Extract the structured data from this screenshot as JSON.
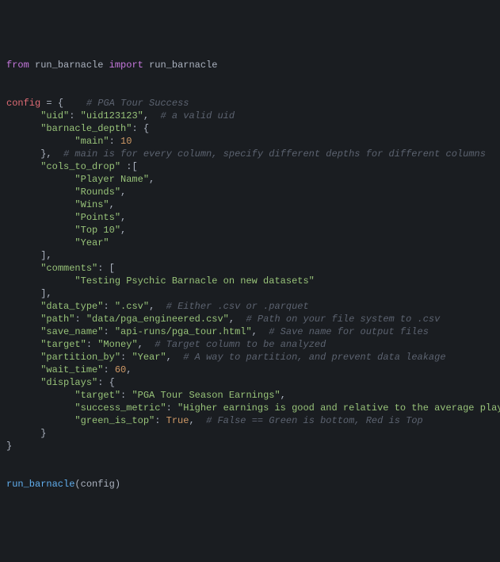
{
  "import_line": {
    "from_kw": "from",
    "module": "run_barnacle",
    "import_kw": "import",
    "name": "run_barnacle"
  },
  "config": {
    "var_name": "config",
    "top_comment": "# PGA Tour Success",
    "keys": {
      "uid": "\"uid\"",
      "uid_val": "\"uid123123\"",
      "uid_cmt": "# a valid uid",
      "barnacle_depth": "\"barnacle_depth\"",
      "main_key": "\"main\"",
      "main_val": "10",
      "depth_cmt": "# main is for every column, specify different depths for different columns",
      "cols_to_drop": "\"cols_to_drop\"",
      "cols": [
        "\"Player Name\"",
        "\"Rounds\"",
        "\"Wins\"",
        "\"Points\"",
        "\"Top 10\"",
        "\"Year\""
      ],
      "comments_key": "\"comments\"",
      "comments_val": "\"Testing Psychic Barnacle on new datasets\"",
      "data_type": "\"data_type\"",
      "data_type_val": "\".csv\"",
      "data_type_cmt": "# Either .csv or .parquet",
      "path": "\"path\"",
      "path_val": "\"data/pga_engineered.csv\"",
      "path_cmt": "# Path on your file system to .csv",
      "save_name": "\"save_name\"",
      "save_name_val": "\"api-runs/pga_tour.html\"",
      "save_name_cmt": "# Save name for output files",
      "target": "\"target\"",
      "target_val": "\"Money\"",
      "target_cmt": "# Target column to be analyzed",
      "partition_by": "\"partition_by\"",
      "partition_by_val": "\"Year\"",
      "partition_by_cmt": "# A way to partition, and prevent data leakage",
      "wait_time": "\"wait_time\"",
      "wait_time_val": "60",
      "displays": "\"displays\"",
      "disp_target_k": "\"target\"",
      "disp_target_v": "\"PGA Tour Season Earnings\"",
      "disp_sm_k": "\"success_metric\"",
      "disp_sm_v": "\"Higher earnings is good and relative to the average player\"",
      "disp_git_k": "\"green_is_top\"",
      "disp_git_v": "True",
      "disp_git_cmt": "# False == Green is bottom, Red is Top"
    }
  },
  "call": {
    "fn": "run_barnacle",
    "arg": "config"
  }
}
